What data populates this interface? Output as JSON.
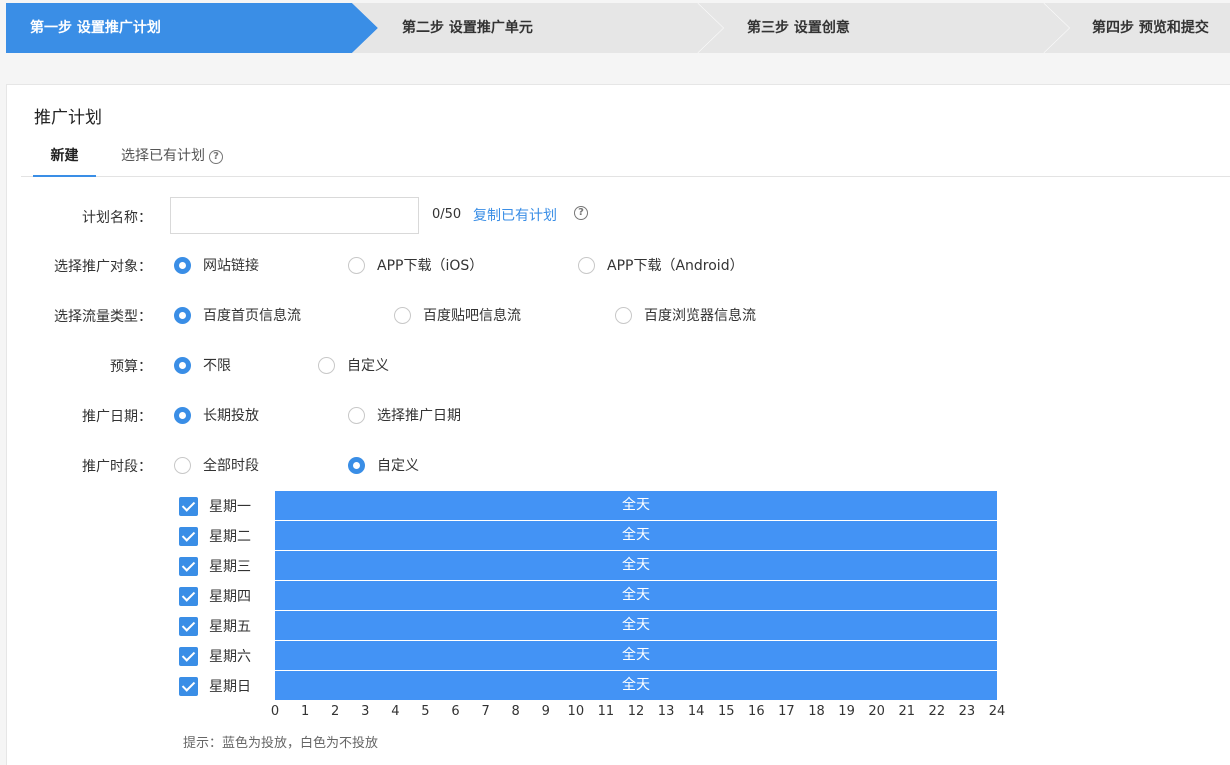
{
  "steps": [
    {
      "label": "第一步 设置推广计划",
      "active": true
    },
    {
      "label": "第二步 设置推广单元",
      "active": false
    },
    {
      "label": "第三步 设置创意",
      "active": false
    },
    {
      "label": "第四步 预览和提交",
      "active": false
    }
  ],
  "colors": {
    "accent": "#3a8ee6",
    "bar": "#4393f5",
    "step_inactive": "#e6e6e6"
  },
  "panel": {
    "title": "推广计划",
    "tabs": [
      {
        "label": "新建"
      },
      {
        "label": "选择已有计划"
      }
    ],
    "help_icon": "question-circle-icon"
  },
  "form": {
    "name": {
      "label": "计划名称：",
      "value": "",
      "count": "0/50",
      "copy_link": "复制已有计划"
    },
    "target": {
      "label": "选择推广对象：",
      "options": [
        "网站链接",
        "APP下载（iOS）",
        "APP下载（Android）"
      ],
      "selected": 0
    },
    "traffic": {
      "label": "选择流量类型：",
      "options": [
        "百度首页信息流",
        "百度贴吧信息流",
        "百度浏览器信息流"
      ],
      "selected": 0
    },
    "budget": {
      "label": "预算：",
      "options": [
        "不限",
        "自定义"
      ],
      "selected": 0
    },
    "date": {
      "label": "推广日期：",
      "options": [
        "长期投放",
        "选择推广日期"
      ],
      "selected": 0
    },
    "time": {
      "label": "推广时段：",
      "options": [
        "全部时段",
        "自定义"
      ],
      "selected": 1
    }
  },
  "schedule": {
    "days": [
      "星期一",
      "星期二",
      "星期三",
      "星期四",
      "星期五",
      "星期六",
      "星期日"
    ],
    "checked": [
      true,
      true,
      true,
      true,
      true,
      true,
      true
    ],
    "bar_label": "全天",
    "hours": [
      "0",
      "1",
      "2",
      "3",
      "4",
      "5",
      "6",
      "7",
      "8",
      "9",
      "10",
      "11",
      "12",
      "13",
      "14",
      "15",
      "16",
      "17",
      "18",
      "19",
      "20",
      "21",
      "22",
      "23",
      "24"
    ],
    "hint": "提示：蓝色为投放，白色为不投放"
  }
}
